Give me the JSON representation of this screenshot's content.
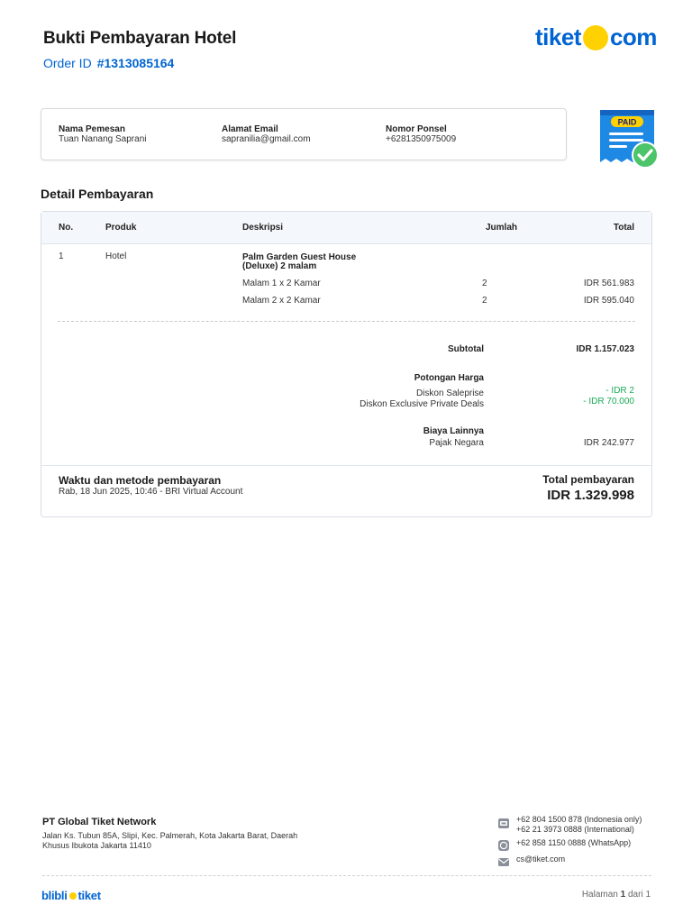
{
  "header": {
    "title": "Bukti Pembayaran Hotel",
    "order_label": "Order ID",
    "order_id": "#1313085164",
    "brand_left": "tiket",
    "brand_right": "com"
  },
  "customer": {
    "name_label": "Nama Pemesan",
    "name": "Tuan Nanang Saprani",
    "email_label": "Alamat Email",
    "email": "sapranilia@gmail.com",
    "phone_label": "Nomor Ponsel",
    "phone": "+6281350975009"
  },
  "badge": {
    "text": "PAID"
  },
  "details": {
    "section_title": "Detail Pembayaran",
    "columns": {
      "no": "No.",
      "product": "Produk",
      "description": "Deskripsi",
      "qty": "Jumlah",
      "total": "Total"
    },
    "row": {
      "no": "1",
      "product": "Hotel",
      "title_line1": "Palm Garden Guest House",
      "title_line2": "(Deluxe) 2 malam",
      "items": [
        {
          "desc": "Malam 1 x 2 Kamar",
          "qty": "2",
          "total": "IDR 561.983"
        },
        {
          "desc": "Malam 2 x 2 Kamar",
          "qty": "2",
          "total": "IDR 595.040"
        }
      ]
    },
    "subtotal_label": "Subtotal",
    "subtotal": "IDR 1.157.023",
    "discount_header": "Potongan Harga",
    "discounts": [
      {
        "label": "Diskon Saleprise",
        "value": "- IDR 2"
      },
      {
        "label": "Diskon Exclusive Private Deals",
        "value": "- IDR 70.000"
      }
    ],
    "fees_header": "Biaya Lainnya",
    "fees": [
      {
        "label": "Pajak Negara",
        "value": "IDR 242.977"
      }
    ],
    "payment_label": "Waktu dan metode pembayaran",
    "payment_info": "Rab, 18 Jun 2025, 10:46 - BRI Virtual Account",
    "total_label": "Total pembayaran",
    "total_value": "IDR 1.329.998"
  },
  "footer": {
    "company": "PT Global Tiket Network",
    "address": "Jalan Ks. Tubun 85A, Slipi, Kec. Palmerah, Kota Jakarta Barat, Daerah Khusus Ibukota Jakarta 11410",
    "phone1": "+62 804 1500 878 (Indonesia only)",
    "phone2": "+62 21 3973 0888 (International)",
    "whatsapp": "+62 858 1150 0888 (WhatsApp)",
    "email": "cs@tiket.com",
    "logo_left": "blibli",
    "logo_right": "tiket",
    "page_prefix": "Halaman",
    "page_current": "1",
    "page_suffix": "dari 1"
  },
  "colors": {
    "brand_blue": "#0064d2",
    "brand_yellow": "#ffd100",
    "discount_green": "#1aaa55",
    "paid_check_green": "#4cc46a"
  }
}
